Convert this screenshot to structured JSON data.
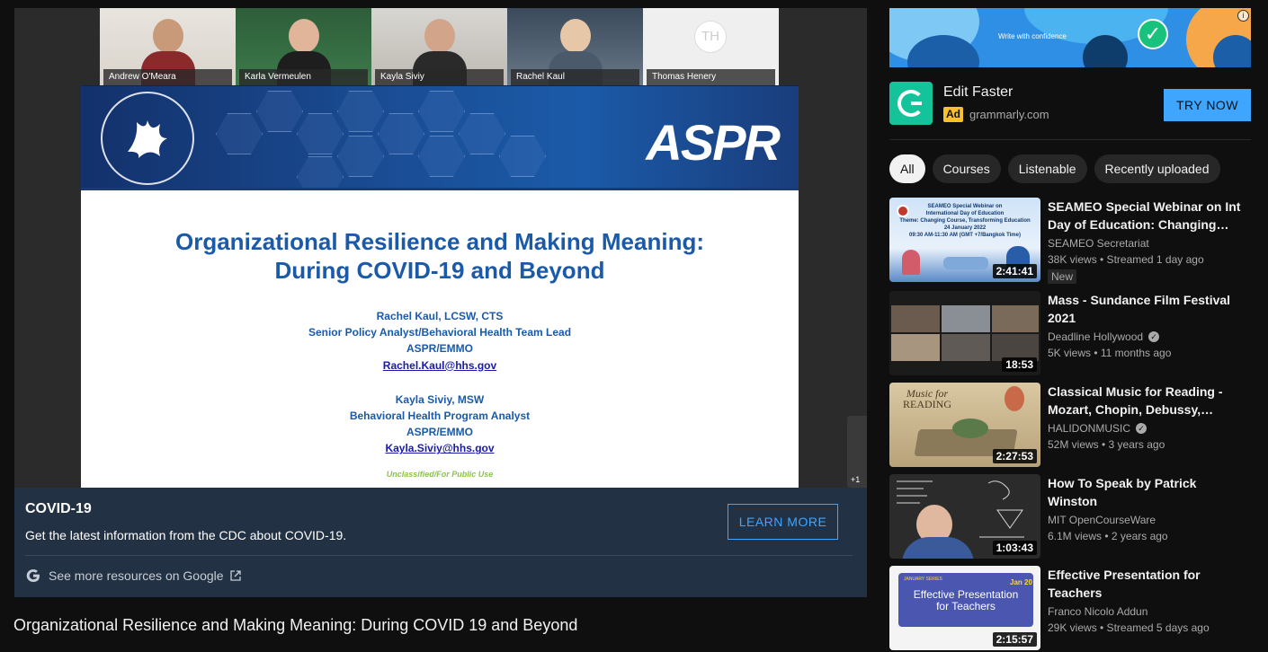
{
  "player": {
    "participants": [
      {
        "name": "Andrew O'Meara"
      },
      {
        "name": "Karla Vermeulen"
      },
      {
        "name": "Kayla Siviy"
      },
      {
        "name": "Rachel Kaul"
      },
      {
        "name": "Thomas Henery",
        "initials": "TH"
      }
    ],
    "slide": {
      "logo_text": "ASPR",
      "title_line1": "Organizational Resilience and Making Meaning:",
      "title_line2": "During COVID-19 and Beyond",
      "presenter1_name": "Rachel Kaul, LCSW, CTS",
      "presenter1_role": "Senior Policy Analyst/Behavioral Health Team Lead",
      "presenter1_org": "ASPR/EMMO",
      "presenter1_email": "Rachel.Kaul@hhs.gov",
      "presenter2_name": "Kayla Siviy, MSW",
      "presenter2_role": "Behavioral Health Program Analyst",
      "presenter2_org": "ASPR/EMMO",
      "presenter2_email": "Kayla.Siviy@hhs.gov",
      "footer": "Unclassified/For Public Use"
    },
    "overflow_count": "+1"
  },
  "info_panel": {
    "title": "COVID-19",
    "description": "Get the latest information from the CDC about COVID-19.",
    "button_label": "LEARN MORE",
    "google_link": "See more resources on Google"
  },
  "video_title": "Organizational Resilience and Making Meaning: During COVID 19 and Beyond",
  "ad": {
    "banner_text": "Write with confidence",
    "title": "Edit Faster",
    "badge": "Ad",
    "domain": "grammarly.com",
    "cta": "TRY NOW"
  },
  "chips": [
    "All",
    "Courses",
    "Listenable",
    "Recently uploaded"
  ],
  "recommendations": [
    {
      "title": "SEAMEO Special Webinar on Int Day of Education: Changing…",
      "channel": "SEAMEO Secretariat",
      "verified": false,
      "meta": "38K views • Streamed 1 day ago",
      "duration": "2:41:41",
      "badge": "New"
    },
    {
      "title": "Mass - Sundance Film Festival 2021",
      "channel": "Deadline Hollywood",
      "verified": true,
      "meta": "5K views • 11 months ago",
      "duration": "18:53"
    },
    {
      "title": "Classical Music for Reading - Mozart, Chopin, Debussy,…",
      "channel": "HALIDONMUSIC",
      "verified": true,
      "meta": "52M views • 3 years ago",
      "duration": "2:27:53"
    },
    {
      "title": "How To Speak by Patrick Winston",
      "channel": "MIT OpenCourseWare",
      "verified": false,
      "meta": "6.1M views • 2 years ago",
      "duration": "1:03:43"
    },
    {
      "title": "Effective Presentation for Teachers",
      "channel": "Franco Nicolo Addun",
      "verified": false,
      "meta": "29K views • Streamed 5 days ago",
      "duration": "2:15:57"
    }
  ],
  "thumb_text": {
    "seameo": [
      "SEAMEO Special Webinar on",
      "International Day of Education",
      "Theme: Changing Course, Transforming Education",
      "24 January 2022",
      "09:30 AM-11:30 AM (GMT +7/Bangkok Time)"
    ],
    "classical": [
      "Music for",
      "READING"
    ],
    "effective": [
      "JANUARY SERIES",
      "Jan 20",
      "Effective Presentation",
      "for Teachers"
    ]
  },
  "colors": {
    "background": "#0f0f0f",
    "accent_blue": "#3ea6ff",
    "info_panel": "#233144",
    "ad_badge": "#fbc02d",
    "grammarly_green": "#15c39a",
    "slide_title": "#1a5aa8"
  }
}
